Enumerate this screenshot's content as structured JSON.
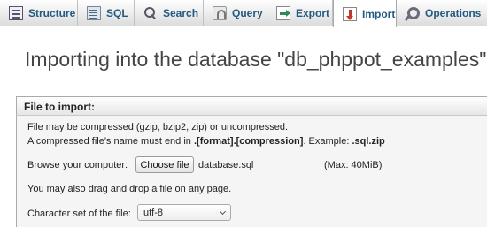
{
  "tabs": [
    {
      "label": "Structure",
      "icon": "structure-icon",
      "active": false
    },
    {
      "label": "SQL",
      "icon": "sql-icon",
      "active": false
    },
    {
      "label": "Search",
      "icon": "search-icon",
      "active": false
    },
    {
      "label": "Query",
      "icon": "query-icon",
      "active": false
    },
    {
      "label": "Export",
      "icon": "export-icon",
      "active": false
    },
    {
      "label": "Import",
      "icon": "import-icon",
      "active": true
    },
    {
      "label": "Operations",
      "icon": "operations-icon",
      "active": false
    }
  ],
  "page_title": "Importing into the database \"db_phppot_examples\"",
  "file_section": {
    "legend": "File to import:",
    "compress_note": "File may be compressed (gzip, bzip2, zip) or uncompressed.",
    "name_note_prefix": "A compressed file's name must end in ",
    "name_note_pattern": ".[format].[compression]",
    "name_note_example_prefix": ". Example: ",
    "name_note_example": ".sql.zip",
    "browse_label": "Browse your computer:",
    "choose_button": "Choose file",
    "chosen_file": "database.sql",
    "max_size": "(Max: 40MiB)",
    "drag_note": "You may also drag and drop a file on any page.",
    "charset_label": "Character set of the file:",
    "charset_value": "utf-8"
  },
  "colors": {
    "tab_text": "#235a81",
    "legend_bg": "#e6e6e6",
    "body_bg": "#f5f5f5"
  }
}
